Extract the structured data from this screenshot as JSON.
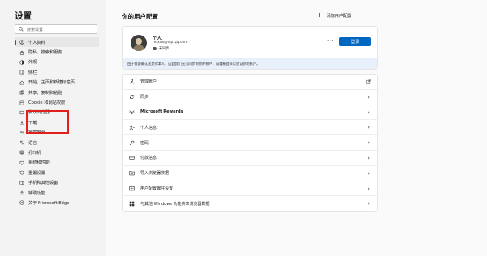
{
  "sidebar": {
    "title": "设置",
    "search_placeholder": "搜索设置",
    "items": [
      {
        "label": "个人资料",
        "icon": "profile-icon",
        "active": true
      },
      {
        "label": "隐私、搜索和服务",
        "icon": "lock-icon"
      },
      {
        "label": "外观",
        "icon": "appearance-icon"
      },
      {
        "label": "侧栏",
        "icon": "sidebar-icon"
      },
      {
        "label": "开始、主页和新建标签页",
        "icon": "home-icon"
      },
      {
        "label": "共享、复制和粘贴",
        "icon": "share-icon"
      },
      {
        "label": "Cookie 和网站权限",
        "icon": "cookie-icon"
      },
      {
        "label": "默认浏览器",
        "icon": "browser-icon"
      },
      {
        "label": "下载",
        "icon": "download-icon"
      },
      {
        "label": "家庭安全",
        "icon": "family-icon"
      },
      {
        "label": "语言",
        "icon": "language-icon"
      },
      {
        "label": "打印机",
        "icon": "printer-icon"
      },
      {
        "label": "系统和性能",
        "icon": "system-icon"
      },
      {
        "label": "重置设置",
        "icon": "reset-icon"
      },
      {
        "label": "手机和其他设备",
        "icon": "phone-icon"
      },
      {
        "label": "辅助功能",
        "icon": "accessibility-icon"
      },
      {
        "label": "关于 Microsoft Edge",
        "icon": "edge-icon"
      }
    ]
  },
  "main": {
    "title": "你的用户配置",
    "add_profile": "添加用户配置",
    "profile": {
      "name": "个人",
      "email": "mrxxx@vip.qq.com",
      "sync_status": "未同步",
      "more": "···",
      "signin_label": "登录"
    },
    "notice": "由于需要确认这是你本人，因此我们无法同步到你的帐户。请重新登录以验证你的帐户。",
    "rows": [
      {
        "label": "管理帐户",
        "icon": "person-icon",
        "trail": "external-link-icon"
      },
      {
        "label": "同步",
        "icon": "sync-icon",
        "trail": "chevron-right-icon"
      },
      {
        "label": "Microsoft Rewards",
        "icon": "rewards-icon",
        "trail": "chevron-right-icon",
        "bold": true
      },
      {
        "label": "个人信息",
        "icon": "person-info-icon",
        "trail": "chevron-right-icon"
      },
      {
        "label": "密码",
        "icon": "key-icon",
        "trail": "chevron-right-icon"
      },
      {
        "label": "付款信息",
        "icon": "card-icon",
        "trail": "chevron-right-icon"
      },
      {
        "label": "导入浏览器数据",
        "icon": "import-icon",
        "trail": "chevron-right-icon"
      },
      {
        "label": "用户配置偏好设置",
        "icon": "preferences-icon",
        "trail": "chevron-right-icon"
      },
      {
        "label": "与其他 Windows 功能共享浏览器数据",
        "icon": "windows-icon",
        "trail": "chevron-right-icon"
      }
    ]
  },
  "colors": {
    "accent": "#0067c0",
    "highlight": "#e0201c",
    "notice_bg": "#e8f0fb"
  }
}
